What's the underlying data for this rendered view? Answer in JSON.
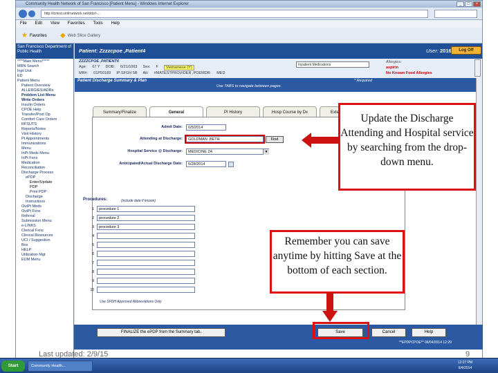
{
  "browser": {
    "title": "Community Health Network of San Francisco [Patient Menu] - Windows Internet Explorer",
    "url": "http://lcrtest.smfrnetwork.net/ddcrl-...",
    "menu": [
      "File",
      "Edit",
      "View",
      "Favorites",
      "Tools",
      "Help"
    ],
    "favorites_label": "Favorites",
    "web_slice_label": "Web Slice Gallery"
  },
  "sidebar": {
    "header": "San Francisco Department of Public Health",
    "items": [
      {
        "label": "****Main Menu*****",
        "level": 0
      },
      {
        "label": "MRN Search",
        "level": 0
      },
      {
        "label": "Inpt Unit",
        "level": 0
      },
      {
        "label": "ED",
        "level": 0
      },
      {
        "label": "Patient Menu",
        "level": 0
      },
      {
        "label": "Patient Overview",
        "level": 1
      },
      {
        "label": "ALLERGIES/ADRs",
        "level": 1
      },
      {
        "label": "Problem List Menu",
        "level": 1,
        "bold": true
      },
      {
        "label": "Write Orders",
        "level": 1,
        "bold": true
      },
      {
        "label": "Insulin Orders",
        "level": 1
      },
      {
        "label": "CPOE Help",
        "level": 1
      },
      {
        "label": "Transfer/Post Op",
        "level": 1
      },
      {
        "label": "Comfort Care Orders",
        "level": 1
      },
      {
        "label": "RFSUTS",
        "level": 1
      },
      {
        "label": "Reports/Notes",
        "level": 1
      },
      {
        "label": "Visit History",
        "level": 1
      },
      {
        "label": "Pt Appointments",
        "level": 1
      },
      {
        "label": "Immunizations",
        "level": 1
      },
      {
        "label": "Menu",
        "level": 1
      },
      {
        "label": "InPt Meds Menu",
        "level": 1
      },
      {
        "label": "InPt Fxns",
        "level": 1
      },
      {
        "label": "Medication",
        "level": 1
      },
      {
        "label": "Reconciliation",
        "level": 1
      },
      {
        "label": "Discharge Process",
        "level": 1
      },
      {
        "label": "ePDP",
        "level": 2
      },
      {
        "label": "Enter/Update",
        "level": 3,
        "on": true
      },
      {
        "label": "PDP",
        "level": 3,
        "on": true
      },
      {
        "label": "Print PDP",
        "level": 3
      },
      {
        "label": "Discharge",
        "level": 2
      },
      {
        "label": "Instructions",
        "level": 2
      },
      {
        "label": "OutPt Meds",
        "level": 1
      },
      {
        "label": "OutPt Fxns",
        "level": 1
      },
      {
        "label": "Referral",
        "level": 1
      },
      {
        "label": "Submission Menu",
        "level": 1
      },
      {
        "label": "e-LINKS",
        "level": 1
      },
      {
        "label": "Clerical Fxns",
        "level": 1
      },
      {
        "label": "Clinical Resources",
        "level": 1
      },
      {
        "label": "UCI / Suggestion",
        "level": 1
      },
      {
        "label": "Box",
        "level": 1
      },
      {
        "label": "HELP",
        "level": 1
      },
      {
        "label": "Utilization Mgt",
        "level": 1
      },
      {
        "label": "EUM Menu",
        "level": 1
      }
    ]
  },
  "header": {
    "patient_label": "Patient: Zzzzcpoe ,Patient4",
    "user_label": "User:",
    "user_id": "201673",
    "logoff_label": "Log Off"
  },
  "demographics": {
    "name_line": "ZZZZCPOE ,PATIENT4",
    "age_label": "Age:",
    "age": "67 Y",
    "dob_label": "DOB:",
    "dob": "6/21/1063",
    "sex_label": "Sex:",
    "sex": "F",
    "mrn_label": "MR#:",
    "mrn": "01P50183",
    "att_label": "Att:",
    "att": "#MATESTPROVIDER ,POEMDR:",
    "dept": "IP:SFGH 5B",
    "unit": "MED",
    "select_value": "Inpatient Medications",
    "allergies_label": "Allergies:",
    "allergy1": "aspirin",
    "allergy2": "No Known Food Allergies",
    "lang_value": "Vietnamese (Y)"
  },
  "section": {
    "title": "Patient Discharge Summary & Plan",
    "hint": "Use TABS to navigate between pages.",
    "required": "* Required"
  },
  "tabs": [
    "Summary/Finalize",
    "General",
    "PI History",
    "Hosp Course by Dx",
    "Extended Hosp..."
  ],
  "form": {
    "admit_label": "Admit Date:",
    "admit_value": "6/5/2014",
    "attending_label": "Attending at Discharge:",
    "attending_value": "GOLDMAN ,BETH",
    "find_label": "Find",
    "service_label": "Hospital Service @ Discharge:",
    "service_value": "MEDICINE 2A",
    "discharge_label": "Anticipated/Actual Discharge Date:",
    "discharge_value": "5/28/2014"
  },
  "procedures": {
    "label": "Procedures:",
    "hint": "(include date if known)",
    "rows": [
      {
        "num": "1",
        "value": "procedure 1"
      },
      {
        "num": "2",
        "value": "procedure 2"
      },
      {
        "num": "3",
        "value": "procedure 3"
      },
      {
        "num": "4",
        "value": ""
      },
      {
        "num": "5",
        "value": ""
      },
      {
        "num": "6",
        "value": ""
      },
      {
        "num": "7",
        "value": ""
      },
      {
        "num": "8",
        "value": ""
      },
      {
        "num": "9",
        "value": ""
      },
      {
        "num": "10",
        "value": ""
      }
    ],
    "note": "Use SFDH Approved Abbreviations Only"
  },
  "footer": {
    "finalize_label": "FINALIZE the ePDP from the Summary tab.",
    "save_label": "Save",
    "cancel_label": "Cancel",
    "help_label": "Help",
    "status_text": "**EPDPCPOE**   06/04/2014 12:29"
  },
  "taskbar": {
    "start_label": "Start",
    "item_label": "Community Health...",
    "clock_time": "12:27 PM",
    "clock_date": "6/4/2014"
  },
  "callouts": {
    "discharge_text": "Update the Discharge Attending and Hospital service by searching from the drop-down menu.",
    "save_text": "Remember you can save anytime by hitting Save at the bottom of each section."
  },
  "slide": {
    "last_updated": "Last updated: 2/9/15",
    "page_number": "9"
  },
  "colors": {
    "header_blue": "#1f4f97",
    "callout_red": "#dd1111",
    "logoff_orange": "#f2b134"
  }
}
